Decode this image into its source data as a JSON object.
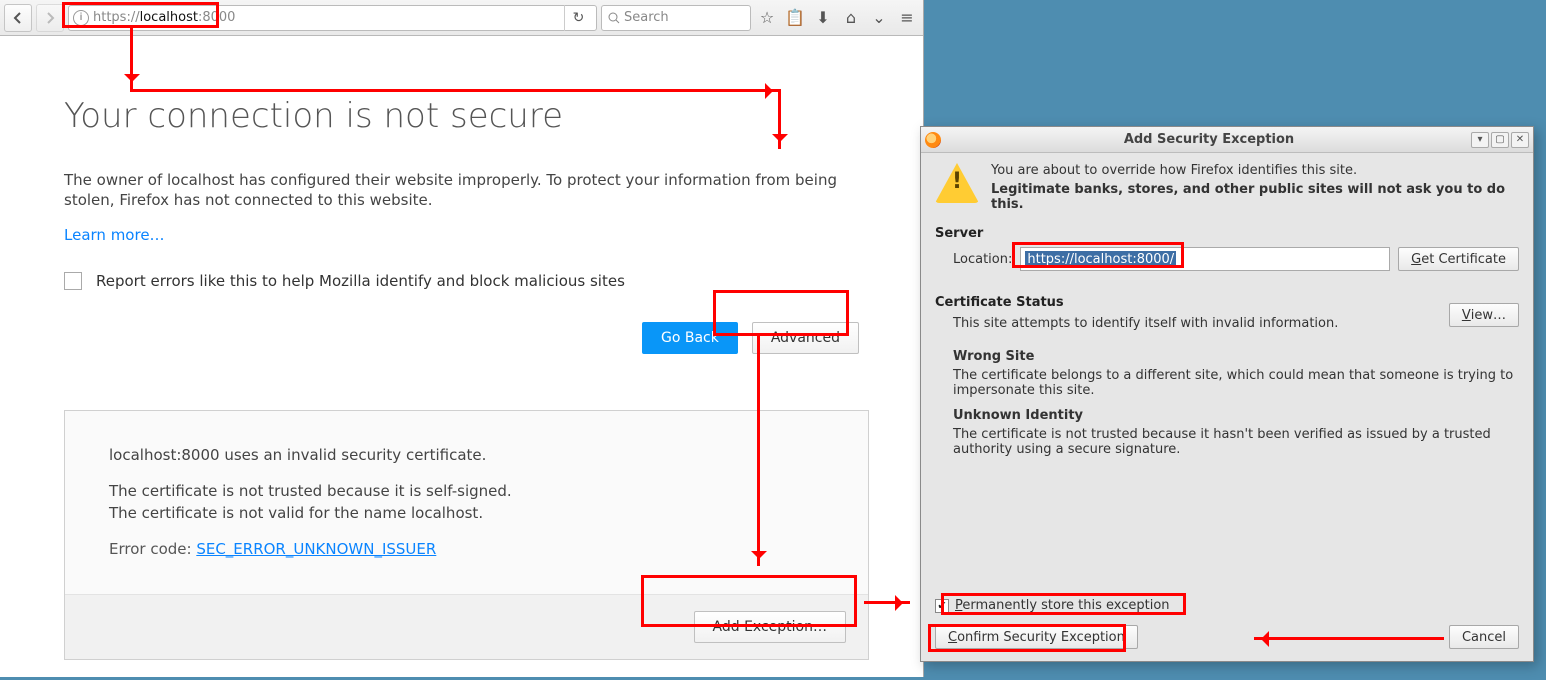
{
  "browser": {
    "url_scheme": "https://",
    "url_host": "localhost",
    "url_port": ":8000",
    "search_placeholder": "Search"
  },
  "page": {
    "heading": "Your connection is not secure",
    "desc": "The owner of localhost has configured their website improperly. To protect your information from being stolen, Firefox has not connected to this website.",
    "learn_more": "Learn more…",
    "report_label": "Report errors like this to help Mozilla identify and block malicious sites",
    "go_back": "Go Back",
    "advanced": "Advanced",
    "adv_line1": "localhost:8000 uses an invalid security certificate.",
    "adv_line2": "The certificate is not trusted because it is self-signed.",
    "adv_line3": "The certificate is not valid for the name localhost.",
    "error_code_label": "Error code: ",
    "error_code": "SEC_ERROR_UNKNOWN_ISSUER",
    "add_exception": "Add Exception…"
  },
  "dialog": {
    "title": "Add Security Exception",
    "warn1": "You are about to override how Firefox identifies this site.",
    "warn2": "Legitimate banks, stores, and other public sites will not ask you to do this.",
    "server_hdr": "Server",
    "location_label": "Location:",
    "location_value": "https://localhost:8000/",
    "get_cert": "Get Certificate",
    "cert_status_hdr": "Certificate Status",
    "cert_status_line": "This site attempts to identify itself with invalid information.",
    "view": "View…",
    "wrong_site_hdr": "Wrong Site",
    "wrong_site_line": "The certificate belongs to a different site, which could mean that someone is trying to impersonate this site.",
    "unknown_hdr": "Unknown Identity",
    "unknown_line": "The certificate is not trusted because it hasn't been verified as issued by a trusted authority using a secure signature.",
    "perm_label": "Permanently store this exception",
    "confirm": "Confirm Security Exception",
    "cancel": "Cancel"
  }
}
